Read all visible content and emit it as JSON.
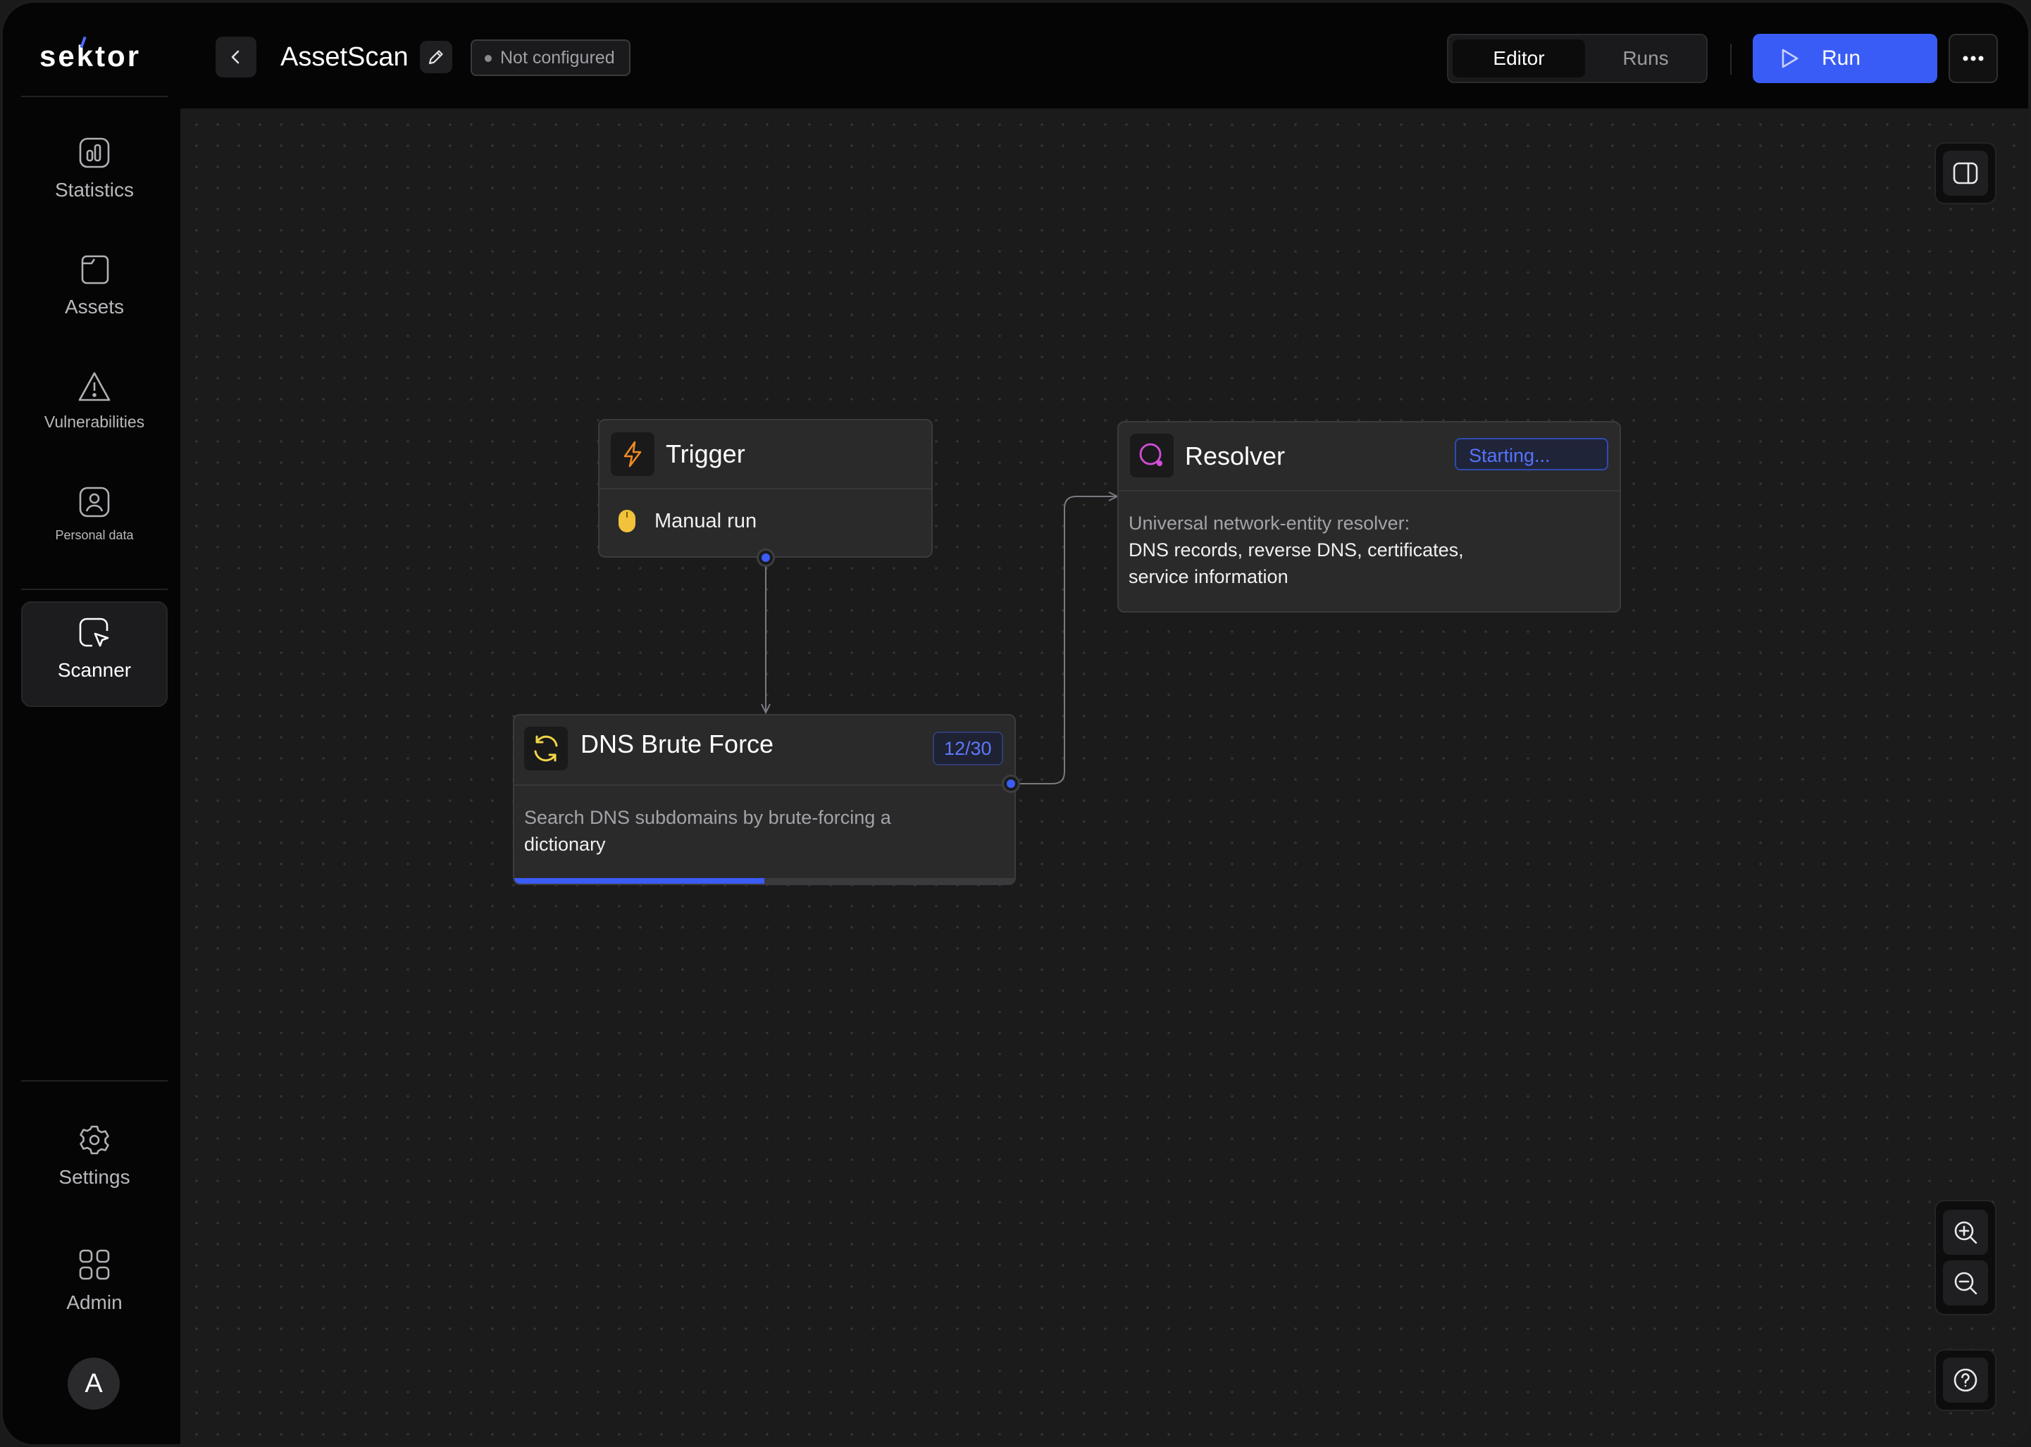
{
  "app": {
    "logo": "sektor"
  },
  "sidebar": {
    "items": [
      {
        "label": "Statistics",
        "icon": "statistics-icon"
      },
      {
        "label": "Assets",
        "icon": "assets-icon"
      },
      {
        "label": "Vulnerabilities",
        "icon": "warning-icon"
      },
      {
        "label": "Personal data",
        "icon": "user-card-icon"
      },
      {
        "label": "Scanner",
        "icon": "scanner-icon",
        "active": true
      },
      {
        "label": "Settings",
        "icon": "gear-icon"
      },
      {
        "label": "Admin",
        "icon": "grid-icon"
      }
    ],
    "avatar": "A"
  },
  "header": {
    "title": "AssetScan",
    "status": "Not configured",
    "tabs": [
      {
        "label": "Editor",
        "active": true
      },
      {
        "label": "Runs",
        "active": false
      }
    ],
    "run_label": "Run"
  },
  "nodes": {
    "trigger": {
      "title": "Trigger",
      "item": "Manual run"
    },
    "dns": {
      "title": "DNS Brute Force",
      "badge": "12/30",
      "desc_muted": "Search DNS subdomains by brute-forcing a",
      "desc": "dictionary",
      "progress": 0.5
    },
    "resolver": {
      "title": "Resolver",
      "status": "Starting...",
      "desc_muted": "Universal network-entity resolver:",
      "desc_line1": "DNS records, reverse DNS, certificates,",
      "desc_line2": "service information"
    }
  },
  "colors": {
    "accent": "#3b5cf6",
    "trigger": "#f08a24",
    "dns": "#f2d648",
    "resolver": "#d44ed8"
  }
}
